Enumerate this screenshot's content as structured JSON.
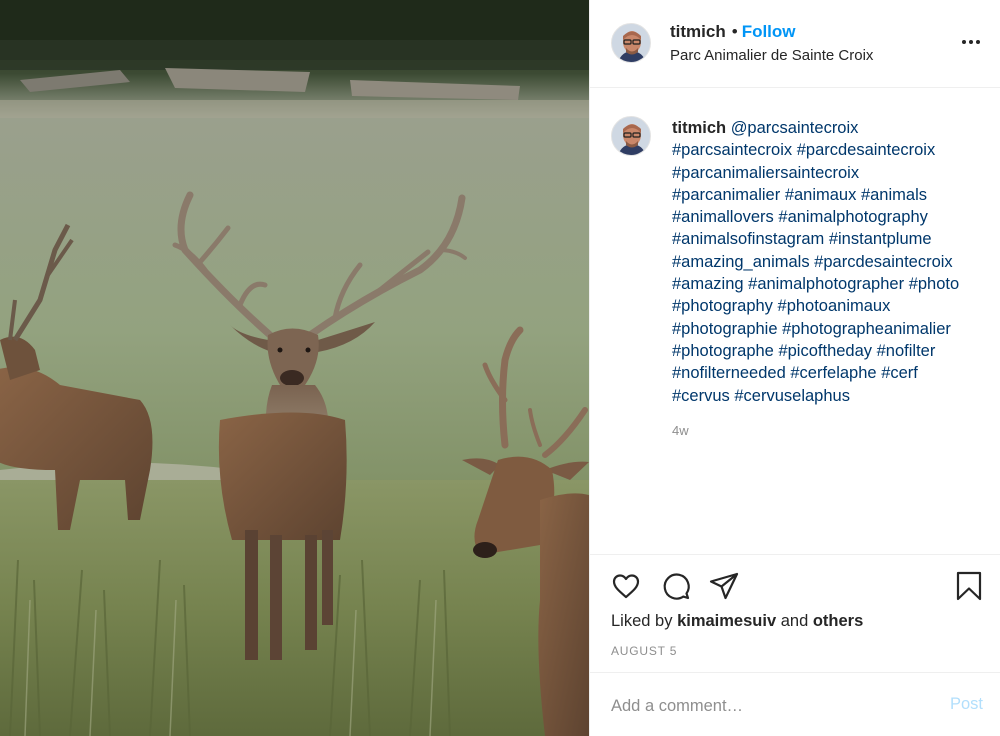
{
  "post": {
    "username": "titmich",
    "separator": "•",
    "follow_label": "Follow",
    "location": "Parc Animalier de Sainte Croix",
    "more_icon": "more-options-icon"
  },
  "caption": {
    "username": "titmich",
    "mention": "@parcsaintecroix",
    "lines": [
      [
        "#parcsaintecroix",
        "#parcdesaintecroix"
      ],
      [
        "#parcanimaliersaintecroix"
      ],
      [
        "#parcanimalier",
        "#animaux",
        "#animals"
      ],
      [
        "#animallovers",
        "#animalphotography"
      ],
      [
        "#animalsofinstagram",
        "#instantplume"
      ],
      [
        "#amazing_animals",
        "#parcdesaintecroix"
      ],
      [
        "#amazing",
        "#animalphotographer",
        "#photo"
      ],
      [
        "#photography",
        "#photoanimaux"
      ],
      [
        "#photographie",
        "#photographeanimalier"
      ],
      [
        "#photographe",
        "#picoftheday",
        "#nofilter"
      ],
      [
        "#nofilterneeded",
        "#cerfelaphe",
        "#cerf"
      ],
      [
        "#cervus",
        "#cervuselaphus"
      ]
    ],
    "age": "4w"
  },
  "actions": {
    "like_icon": "heart-icon",
    "comment_icon": "comment-icon",
    "share_icon": "share-icon",
    "save_icon": "bookmark-icon"
  },
  "likes": {
    "prefix": "Liked by",
    "user": "kimaimesuiv",
    "joiner": "and",
    "others": "others"
  },
  "date": "AUGUST 5",
  "comment": {
    "placeholder": "Add a comment…",
    "post_label": "Post"
  },
  "colors": {
    "link_blue": "#0095f6",
    "hashtag_navy": "#00376b",
    "post_disabled": "#b2dffc",
    "muted": "#8e8e8e",
    "border": "#efefef"
  }
}
